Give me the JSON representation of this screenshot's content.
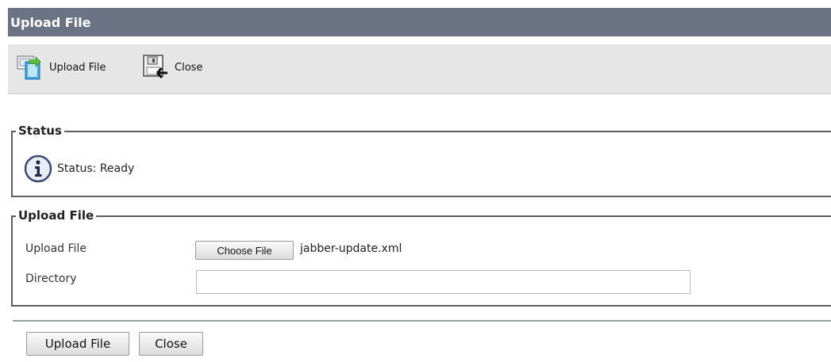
{
  "window": {
    "title": "Upload File"
  },
  "toolbar": {
    "upload_label": "Upload File",
    "upload_icon": "upload-file-icon",
    "close_label": "Close",
    "close_icon": "close-window-icon"
  },
  "status_section": {
    "legend": "Status",
    "icon": "info-icon",
    "text": "Status: Ready"
  },
  "upload_section": {
    "legend": "Upload File",
    "file_label": "Upload File",
    "choose_button": "Choose File",
    "file_name": "jabber-update.xml",
    "directory_label": "Directory",
    "directory_value": ""
  },
  "footer": {
    "upload_button": "Upload File",
    "close_button": "Close"
  },
  "colors": {
    "title_bar": "#6a7383",
    "toolbar": "#e6e6e6",
    "divider": "#8ba3a2"
  }
}
